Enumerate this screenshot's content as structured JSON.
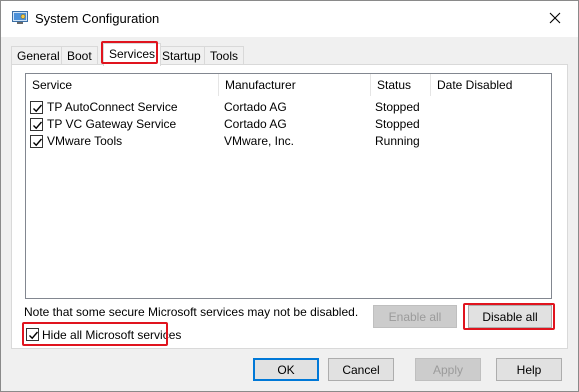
{
  "window": {
    "title": "System Configuration"
  },
  "tabs": [
    {
      "label": "General",
      "active": false
    },
    {
      "label": "Boot",
      "active": false
    },
    {
      "label": "Services",
      "active": true
    },
    {
      "label": "Startup",
      "active": false
    },
    {
      "label": "Tools",
      "active": false
    }
  ],
  "services": {
    "columns": [
      "Service",
      "Manufacturer",
      "Status",
      "Date Disabled"
    ],
    "rows": [
      {
        "checked": true,
        "service": "TP AutoConnect Service",
        "manufacturer": "Cortado AG",
        "status": "Stopped",
        "date_disabled": ""
      },
      {
        "checked": true,
        "service": "TP VC Gateway Service",
        "manufacturer": "Cortado AG",
        "status": "Stopped",
        "date_disabled": ""
      },
      {
        "checked": true,
        "service": "VMware Tools",
        "manufacturer": "VMware, Inc.",
        "status": "Running",
        "date_disabled": ""
      }
    ],
    "note": "Note that some secure Microsoft services may not be disabled.",
    "enable_all_label": "Enable all",
    "disable_all_label": "Disable all",
    "hide_ms_label": "Hide all Microsoft services",
    "hide_ms_checked": true
  },
  "footer": {
    "ok_label": "OK",
    "cancel_label": "Cancel",
    "apply_label": "Apply",
    "help_label": "Help"
  },
  "colors": {
    "highlight": "#e0141e",
    "default_button_border": "#0078d7"
  }
}
